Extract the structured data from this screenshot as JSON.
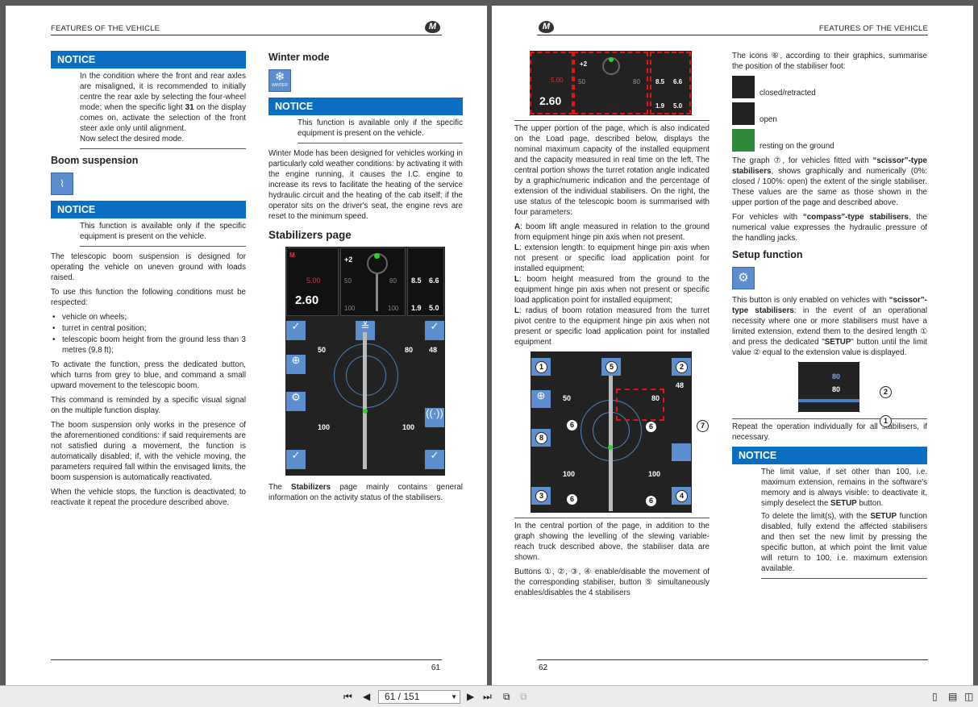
{
  "header": {
    "left_title": "FEATURES OF THE VEHICLE",
    "right_title": "FEATURES OF THE VEHICLE",
    "logo": "M"
  },
  "page_left": {
    "page_number": "61",
    "notice1": {
      "title": "NOTICE",
      "text_a": "In the condition where the front and rear axles are misaligned, it is recommended to initially centre the rear axle by selecting the four-wheel mode; when the specific light ",
      "text_bold": "31",
      "text_b": " on the display comes on, activate the selection of the front steer axle only until alignment.",
      "text_c": "Now select the desired mode."
    },
    "boom": {
      "title": "Boom suspension",
      "notice_title": "NOTICE",
      "notice_text": "This function is available only if the specific equipment is present on the vehicle.",
      "p1": "The telescopic boom suspension is designed for operating the vehicle on uneven ground with loads raised.",
      "p2": "To use this function the following conditions must be respected:",
      "bullets": [
        "vehicle on wheels;",
        "turret in central position;",
        "telescopic boom height from the ground less than 3 metres (9,8 ft);"
      ],
      "p3": "To activate the function, press the dedicated button, which turns from grey to blue, and command a small upward movement to the telescopic boom.",
      "p4": "This command is reminded by a specific visual signal on the multiple function display.",
      "p5": "The boom suspension only works in the presence of the aforementioned conditions: if said requirements are not satisfied during a movement, the function is automatically disabled; if, with the vehicle moving, the parameters required fall within the envisaged limits, the boom suspension is automatically reactivated.",
      "p6": "When the vehicle stops, the function is deactivated; to reactivate it repeat the procedure described above."
    },
    "winter": {
      "title": "Winter mode",
      "icon_label": "WINTER",
      "notice_title": "NOTICE",
      "notice_text": "This function is available only if the specific equipment is present on the vehicle.",
      "p1": "Winter Mode has been designed for vehicles working in particularly cold weather conditions: by activating it with the engine running, it causes the I.C. engine to increase its revs to facilitate the heating of the service hydraulic circuit and the heating of the cab itself; if the operator sits on the driver's seat, the engine revs are reset to the minimum speed."
    },
    "stabilizers": {
      "title": "Stabilizers page",
      "caption_a": "The ",
      "caption_bold": "Stabilizers",
      "caption_b": " page mainly contains general information on the activity status of the stabilisers."
    }
  },
  "page_right": {
    "page_number": "62",
    "p_upper": "The upper portion of the page, which is also indicated on the Load page, described below, displays the nominal maximum capacity of the installed equipment and the capacity measured in real time on the left. The central portion shows the turret rotation angle indicated by a graphic/numeric indication and the percentage of extension of the individual stabilisers. On the right, the use status of the telescopic boom is summarised with four parameters:",
    "params": [
      {
        "key": "A",
        "text": ": boom lift angle measured in relation to the ground from equipment hinge pin axis when not present."
      },
      {
        "key": "L",
        "text": ": extension length: to equipment hinge pin axis when not present or specific load application point for installed equipment;"
      },
      {
        "key": "L",
        "text": ": boom height measured from the ground to the equipment hinge pin axis when not present or specific load application point for installed equipment;"
      },
      {
        "key": "L",
        "text": ": radius of boom rotation measured from the turret pivot centre to the equipment hinge pin axis when not present or specific load application point for installed equipment"
      }
    ],
    "p_central": "In the central portion of the page, in addition to the graph showing the levelling of the slewing variable-reach truck described above, the stabiliser data are shown.",
    "p_buttons": "Buttons ①, ②, ③, ④ enable/disable the movement of the corresponding stabiliser, button ⑤ simultaneously enables/disables the 4 stabilisers",
    "icons_intro": "The icons ⑥, according to their graphics, summarise the position of the stabiliser foot:",
    "states": [
      "closed/retracted",
      "open",
      "resting on the ground"
    ],
    "graph_a": "The graph ⑦, for vehicles fitted with ",
    "graph_bold1": "“scissor”-type stabilisers",
    "graph_b": ", shows graphically and numerically (0%: closed / 100%: open) the extent of the single stabiliser. These values are the same as those shown in the upper portion of the page and described above.",
    "compass_a": "For vehicles with ",
    "compass_bold": "“compass”-type stabilisers",
    "compass_b": ", the numerical value expresses the hydraulic pressure of the handling jacks.",
    "setup_title": "Setup function",
    "setup_a": "This button is only enabled on vehicles with ",
    "setup_bold": "“scissor”-type stabilisers",
    "setup_b": ": in the event of an operational necessity where one or more stabilisers must have a limited extension, extend them to the desired length ① and press the dedicated \"",
    "setup_bold2": "SETUP",
    "setup_c": "\" button until the limit value ② equal to the extension value is displayed.",
    "repeat": "Repeat the operation individually for all stabilisers, if necessary.",
    "notice_title": "NOTICE",
    "notice_p1a": "The limit value, if set other than 100, i.e. maximum extension, remains in the software's memory and is always visible: to deactivate it, simply deselect the ",
    "notice_p1b": "SETUP",
    "notice_p1c": " button.",
    "notice_p2a": "To delete the limit(s), with the ",
    "notice_p2b": "SETUP",
    "notice_p2c": " function disabled, fully extend the affected stabilisers and then set the new limit by pressing the specific button, at which point the limit value will return to 100, i.e. maximum extension available."
  },
  "screen": {
    "cap_nominal": "5.00",
    "cap_real": "2.60",
    "plus": "+2",
    "v50": "50",
    "v80": "80",
    "v100": "100",
    "v48": "48",
    "boom_a": "8.5",
    "boom_b": "6.6",
    "boom_c": "1.9",
    "boom_d": "5.0",
    "callouts": [
      "1",
      "2",
      "3",
      "4",
      "5",
      "6",
      "7",
      "8"
    ]
  },
  "toolbar": {
    "page_indicator": "61 / 151"
  }
}
